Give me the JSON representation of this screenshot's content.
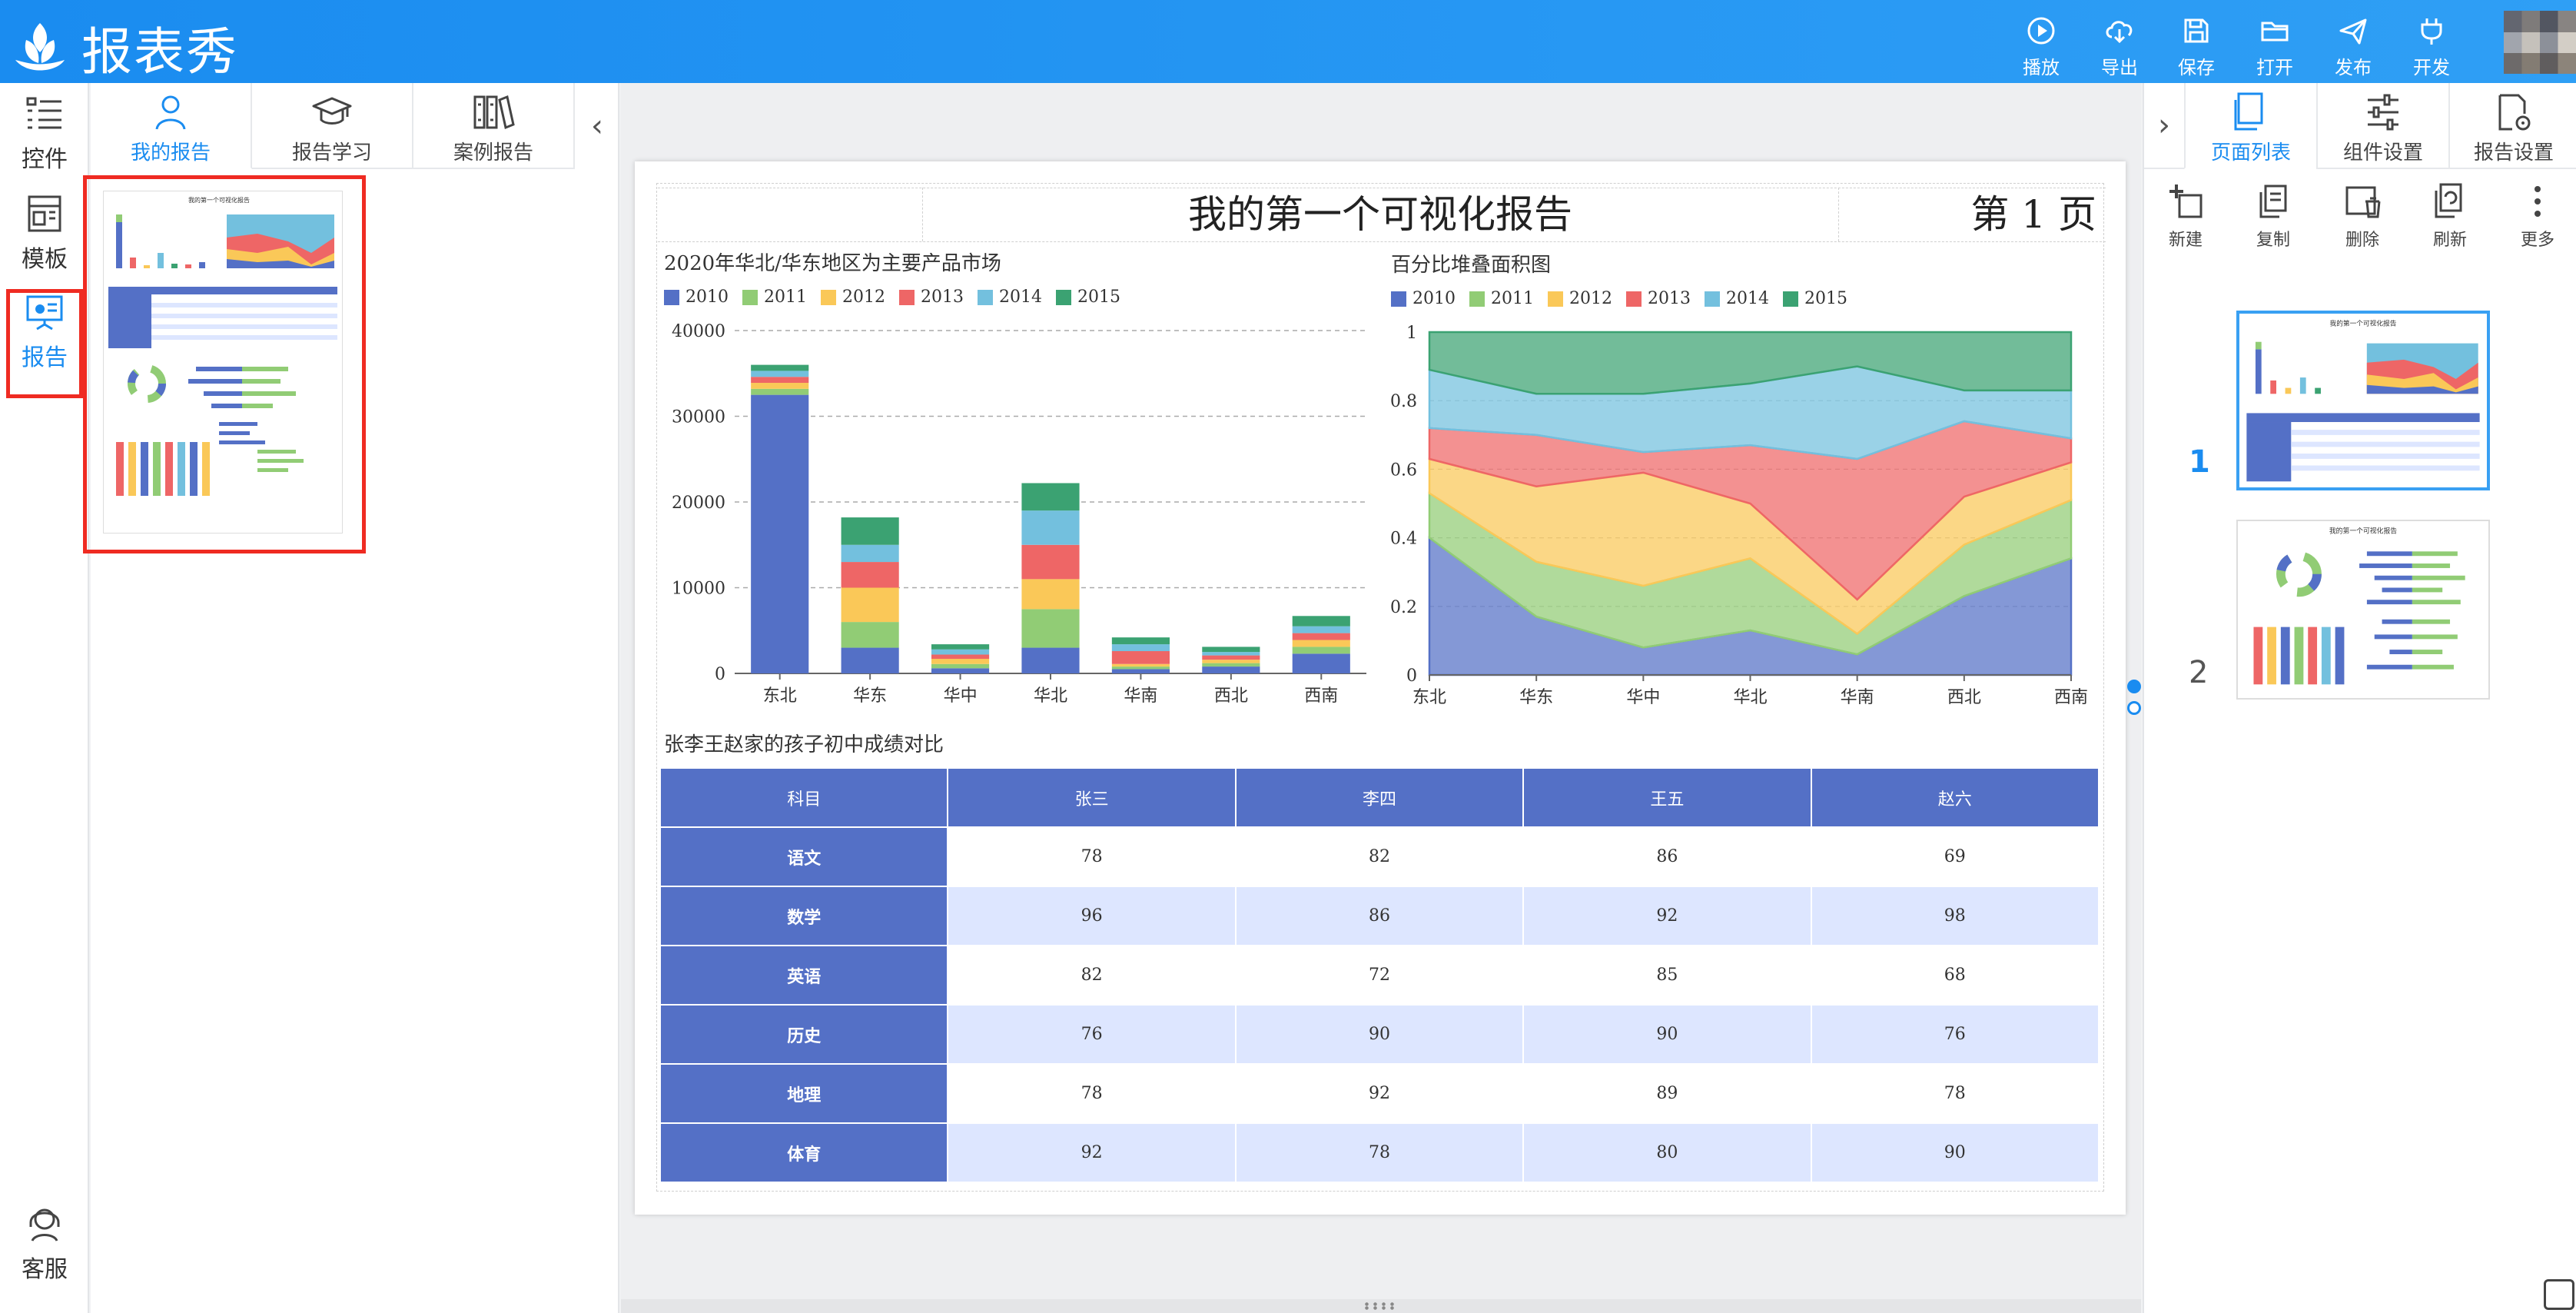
{
  "app": {
    "name": "报表秀"
  },
  "toolbar": [
    {
      "id": "play",
      "label": "播放",
      "icon": "play-icon"
    },
    {
      "id": "export",
      "label": "导出",
      "icon": "cloud-download-icon"
    },
    {
      "id": "save",
      "label": "保存",
      "icon": "floppy-icon"
    },
    {
      "id": "open",
      "label": "打开",
      "icon": "folder-icon"
    },
    {
      "id": "publish",
      "label": "发布",
      "icon": "paper-plane-icon"
    },
    {
      "id": "develop",
      "label": "开发",
      "icon": "plug-icon"
    }
  ],
  "rail": {
    "items": [
      {
        "label": "控件",
        "icon": "widgets-icon"
      },
      {
        "label": "模板",
        "icon": "template-icon"
      },
      {
        "label": "报告",
        "icon": "report-icon",
        "active": true
      }
    ],
    "support": {
      "label": "客服",
      "icon": "headset-icon"
    }
  },
  "panel": {
    "tabs": [
      {
        "label": "我的报告",
        "icon": "user-icon",
        "active": true
      },
      {
        "label": "报告学习",
        "icon": "graduation-cap-icon"
      },
      {
        "label": "案例报告",
        "icon": "binders-icon"
      }
    ],
    "collapse_icon": "‹"
  },
  "report": {
    "title": "我的第一个可视化报告",
    "page_label": "第 1 页"
  },
  "colors": {
    "primary": "#1a8cf0",
    "series": [
      "#5470c6",
      "#91cc75",
      "#fac858",
      "#ee6666",
      "#73c0de",
      "#3ba272"
    ],
    "table_header": "#5470c6",
    "table_stripe": "#dde6ff",
    "highlight": "#ef2b22"
  },
  "chart_data": [
    {
      "type": "bar",
      "stacked": true,
      "title": "2020年华北/华东地区为主要产品市场",
      "categories": [
        "东北",
        "华东",
        "华中",
        "华北",
        "华南",
        "西北",
        "西南"
      ],
      "ylim": [
        0,
        40000
      ],
      "yticks": [
        0,
        10000,
        20000,
        30000,
        40000
      ],
      "grid": true,
      "legend": "top-left",
      "series": [
        {
          "name": "2010",
          "values": [
            32500,
            3000,
            600,
            3000,
            500,
            800,
            2300
          ]
        },
        {
          "name": "2011",
          "values": [
            700,
            3000,
            500,
            4500,
            300,
            400,
            800
          ]
        },
        {
          "name": "2012",
          "values": [
            700,
            4000,
            600,
            3500,
            300,
            400,
            800
          ]
        },
        {
          "name": "2013",
          "values": [
            700,
            3000,
            500,
            4000,
            1500,
            500,
            800
          ]
        },
        {
          "name": "2014",
          "values": [
            700,
            2000,
            600,
            4000,
            800,
            400,
            800
          ]
        },
        {
          "name": "2015",
          "values": [
            700,
            3200,
            600,
            3200,
            800,
            600,
            1200
          ]
        }
      ]
    },
    {
      "type": "area",
      "stacked": true,
      "title": "百分比堆叠面积图",
      "categories": [
        "东北",
        "华东",
        "华中",
        "华北",
        "华南",
        "西北",
        "西南"
      ],
      "ylim": [
        0,
        1
      ],
      "yticks": [
        "0",
        "0.2",
        "0.4",
        "0.6",
        "0.8",
        "1"
      ],
      "legend": "top-left",
      "series": [
        {
          "name": "2010",
          "values": [
            0.4,
            0.17,
            0.08,
            0.13,
            0.06,
            0.23,
            0.34
          ]
        },
        {
          "name": "2011",
          "values": [
            0.13,
            0.16,
            0.18,
            0.21,
            0.06,
            0.15,
            0.17
          ]
        },
        {
          "name": "2012",
          "values": [
            0.1,
            0.22,
            0.33,
            0.16,
            0.1,
            0.14,
            0.11
          ]
        },
        {
          "name": "2013",
          "values": [
            0.09,
            0.15,
            0.06,
            0.17,
            0.41,
            0.22,
            0.07
          ]
        },
        {
          "name": "2014",
          "values": [
            0.17,
            0.12,
            0.17,
            0.18,
            0.27,
            0.09,
            0.14
          ]
        },
        {
          "name": "2015",
          "values": [
            0.11,
            0.18,
            0.18,
            0.15,
            0.1,
            0.17,
            0.17
          ]
        }
      ]
    },
    {
      "type": "table",
      "title": "张李王赵家的孩子初中成绩对比",
      "columns": [
        "科目",
        "张三",
        "李四",
        "王五",
        "赵六"
      ],
      "rows": [
        [
          "语文",
          "78",
          "82",
          "86",
          "69"
        ],
        [
          "数学",
          "96",
          "86",
          "92",
          "98"
        ],
        [
          "英语",
          "82",
          "72",
          "85",
          "68"
        ],
        [
          "历史",
          "76",
          "90",
          "90",
          "76"
        ],
        [
          "地理",
          "78",
          "92",
          "89",
          "78"
        ],
        [
          "体育",
          "92",
          "78",
          "80",
          "90"
        ]
      ]
    }
  ],
  "rpanel": {
    "tabs": [
      {
        "label": "页面列表",
        "icon": "pages-icon",
        "active": true
      },
      {
        "label": "组件设置",
        "icon": "sliders-icon"
      },
      {
        "label": "报告设置",
        "icon": "doc-settings-icon"
      }
    ],
    "expand_icon": "›",
    "tools": [
      {
        "label": "新建",
        "icon": "new-page-icon"
      },
      {
        "label": "复制",
        "icon": "copy-icon"
      },
      {
        "label": "删除",
        "icon": "trash-icon"
      },
      {
        "label": "刷新",
        "icon": "refresh-icon"
      },
      {
        "label": "更多",
        "icon": "more-vertical-icon"
      }
    ],
    "pages": [
      {
        "number": "1",
        "active": true
      },
      {
        "number": "2",
        "active": false
      }
    ]
  }
}
